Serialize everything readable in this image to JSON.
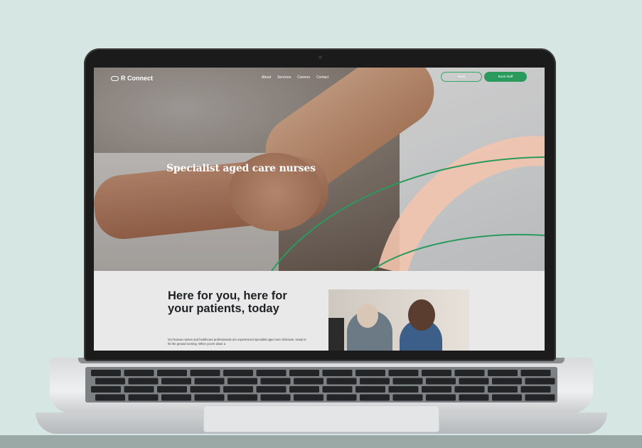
{
  "site": {
    "logo_text": "R Connect",
    "nav": [
      "About",
      "Services",
      "Careers",
      "Contact"
    ],
    "btn_outline": "Work",
    "btn_solid": "Book Staff"
  },
  "hero": {
    "title": "Specialist aged care nurses"
  },
  "section": {
    "heading_line1": "Here for you, here for",
    "heading_line2": "your patients, today",
    "body": "Our bureau nurses and healthcare professionals are experienced specialist aged care clinicians, ready to hit the ground running. When you're down a"
  },
  "colors": {
    "background": "#d5e6e3",
    "brand_green": "#2a9a5d",
    "arc_peach": "#f2c4ae"
  }
}
